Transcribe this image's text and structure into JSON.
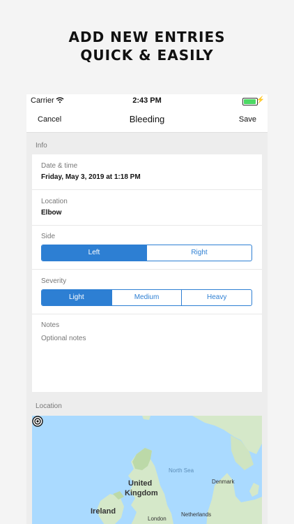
{
  "promo": {
    "line1": "ADD NEW ENTRIES",
    "line2": "QUICK & EASILY"
  },
  "status_bar": {
    "carrier": "Carrier",
    "time": "2:43 PM"
  },
  "nav": {
    "cancel": "Cancel",
    "title": "Bleeding",
    "save": "Save"
  },
  "sections": {
    "info": "Info",
    "location": "Location"
  },
  "fields": {
    "date_label": "Date & time",
    "date_value": "Friday, May 3, 2019 at 1:18 PM",
    "location_label": "Location",
    "location_value": "Elbow",
    "side_label": "Side",
    "side_options": [
      "Left",
      "Right"
    ],
    "severity_label": "Severity",
    "severity_options": [
      "Light",
      "Medium",
      "Heavy"
    ],
    "notes_label": "Notes",
    "notes_placeholder": "Optional notes"
  },
  "map": {
    "labels": {
      "north_sea": "North Sea",
      "denmark": "Denmark",
      "uk_1": "United",
      "uk_2": "Kingdom",
      "ireland": "Ireland",
      "netherlands": "Netherlands",
      "london": "London"
    },
    "colors": {
      "water": "#aadaff",
      "land": "#d5e8c9",
      "land_dark": "#bcd9a8"
    }
  },
  "colors": {
    "accent": "#2d7fd3"
  }
}
